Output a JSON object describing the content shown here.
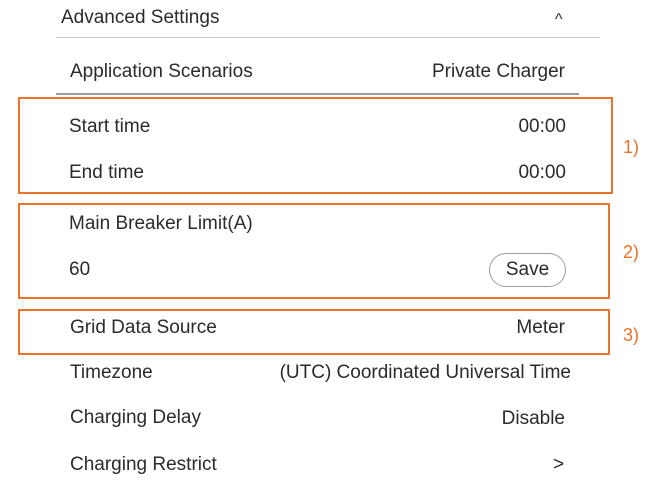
{
  "header": {
    "title": "Advanced Settings",
    "toggle_icon": "^"
  },
  "application": {
    "label": "Application Scenarios",
    "value": "Private Charger"
  },
  "schedule": {
    "start_label": "Start time",
    "start_value": "00:00",
    "end_label": "End time",
    "end_value": "00:00"
  },
  "breaker": {
    "label": "Main Breaker Limit(A)",
    "value": "60",
    "save_label": "Save"
  },
  "grid": {
    "label": "Grid Data Source",
    "value": "Meter"
  },
  "timezone": {
    "label": "Timezone",
    "value": "(UTC) Coordinated Universal Time"
  },
  "delay": {
    "label": "Charging Delay",
    "value": "Disable"
  },
  "restrict": {
    "label": "Charging Restrict",
    "chevron": ">"
  },
  "markers": {
    "one": "1)",
    "two": "2)",
    "three": "3)"
  },
  "colors": {
    "highlight": "#e8732a",
    "text": "#2b2b2b",
    "divider": "#c9c9c9"
  }
}
